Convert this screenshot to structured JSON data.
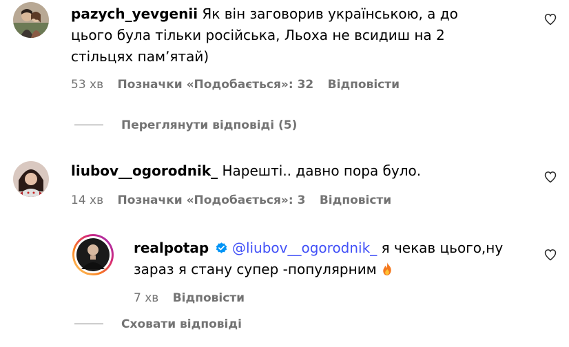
{
  "comments": [
    {
      "username": "pazych_yevgenii",
      "text": "Як він заговорив українською, а до цього була тільки російська, Льоха не всидиш на 2 стільцях памʼятай)",
      "time": "53 хв",
      "likes": "Позначки «Подобається»: 32",
      "reply": "Відповісти"
    },
    {
      "username": "liubov__ogorodnik_",
      "text": "Нарешті.. давно пора було.",
      "time": "14 хв",
      "likes": "Позначки «Подобається»: 3",
      "reply": "Відповісти"
    }
  ],
  "view_replies": "Переглянути відповіді (5)",
  "reply_comment": {
    "username": "realpotap",
    "mention": "@liubov__ogorodnik_",
    "text": "я чекав цього,ну зараз я стану супер -популярним",
    "time": "7 хв",
    "reply": "Відповісти"
  },
  "hide_replies": "Сховати відповіді",
  "colors": {
    "text": "#000000",
    "meta": "#737373",
    "mention": "#4150f7",
    "verified": "#0095f6"
  },
  "icons": [
    "heart-outline-icon",
    "verified-badge-icon",
    "fire-emoji-icon"
  ]
}
